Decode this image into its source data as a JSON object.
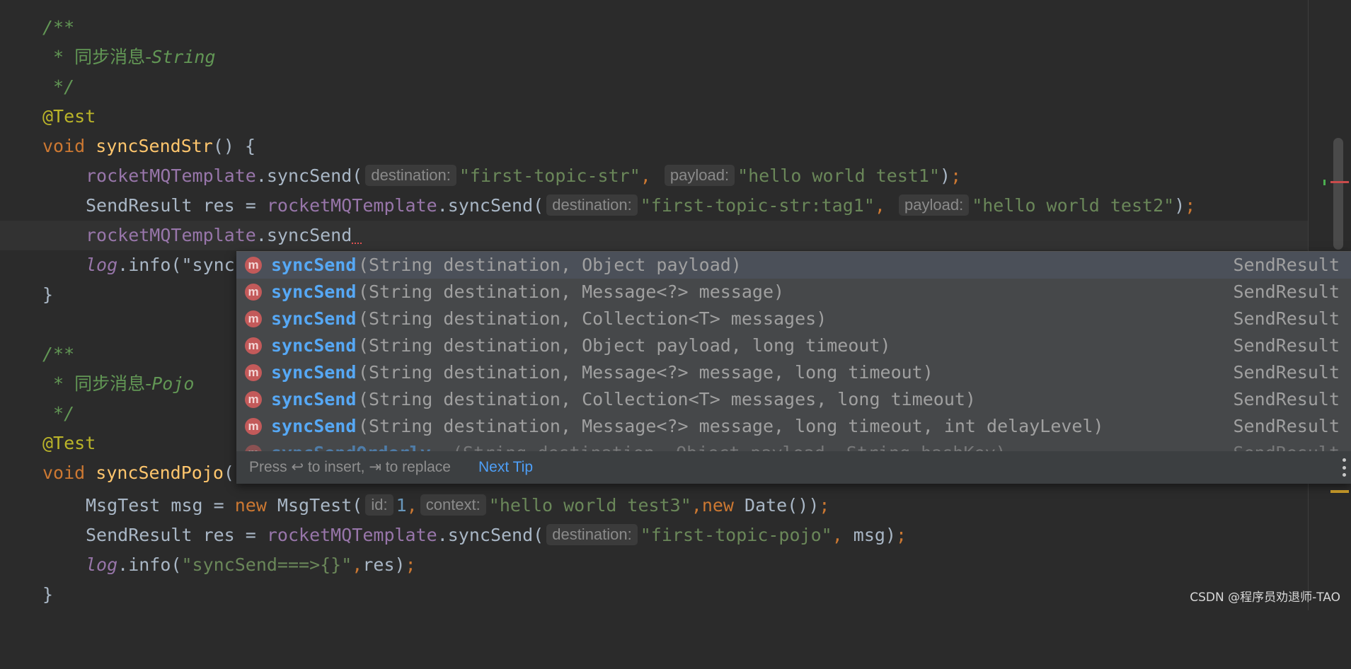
{
  "editor": {
    "comment1_open": "/**",
    "comment1_star": " * ",
    "comment1_cjk": "同步消息-",
    "comment1_word": "String",
    "comment1_close": " */",
    "annotation1": "@Test",
    "method1_kw": "void",
    "method1_name": "syncSendStr",
    "method1_rest": "() {",
    "line6": {
      "obj": "rocketMQTemplate",
      "call": ".syncSend(",
      "hint1": "destination:",
      "arg1": "\"first-topic-str\"",
      "comma1": ",",
      "hint2": "payload:",
      "arg2": "\"hello world test1\"",
      "close": ")",
      "semi": ";"
    },
    "line7": {
      "decl": "SendResult res = ",
      "obj": "rocketMQTemplate",
      "call": ".syncSend(",
      "hint1": "destination:",
      "arg1": "\"first-topic-str:tag1\"",
      "comma1": ",",
      "hint2": "payload:",
      "arg2": "\"hello world test2\"",
      "close": ")",
      "semi": ";"
    },
    "line8": {
      "obj": "rocketMQTemplate",
      "call": ".syncSend"
    },
    "line9": {
      "log": "log",
      "rest": ".info(\"sync"
    },
    "close_brace1": "}",
    "comment2_open": "/**",
    "comment2_star": " * ",
    "comment2_cjk": "同步消息-",
    "comment2_word": "Pojo",
    "comment2_close": " */",
    "annotation2": "@Test",
    "method2_kw": "void",
    "method2_name": "syncSendPojo",
    "method2_rest": "(",
    "line16": {
      "decl": "MsgTest msg = ",
      "kw_new": "new",
      "ctor": " MsgTest(",
      "hint1": "id:",
      "num": "1",
      "comma1": ",",
      "hint2": "context:",
      "arg2": "\"hello world test3\"",
      "comma2": ",",
      "kw_new2": "new",
      "date": " Date())",
      "semi": ";"
    },
    "line17": {
      "decl": "SendResult res = ",
      "obj": "rocketMQTemplate",
      "call": ".syncSend(",
      "hint1": "destination:",
      "arg1": "\"first-topic-pojo\"",
      "comma1": ",",
      "rest": " msg)",
      "semi": ";"
    },
    "line18": {
      "log": "log",
      "call": ".info(",
      "str": "\"syncSend===>{}\"",
      "comma": ",",
      "rest": "res)",
      "semi": ";"
    },
    "close_brace2": "}"
  },
  "completion": {
    "items": [
      {
        "icon": "m",
        "name": "syncSend",
        "params": "(String destination, Object payload)",
        "type": "SendResult"
      },
      {
        "icon": "m",
        "name": "syncSend",
        "params": "(String destination, Message<?> message)",
        "type": "SendResult"
      },
      {
        "icon": "m",
        "name": "syncSend",
        "params": "(String destination, Collection<T> messages)",
        "type": "SendResult"
      },
      {
        "icon": "m",
        "name": "syncSend",
        "params": "(String destination, Object payload, long timeout)",
        "type": "SendResult"
      },
      {
        "icon": "m",
        "name": "syncSend",
        "params": "(String destination, Message<?> message, long timeout)",
        "type": "SendResult"
      },
      {
        "icon": "m",
        "name": "syncSend",
        "params": "(String destination, Collection<T> messages, long timeout)",
        "type": "SendResult"
      },
      {
        "icon": "m",
        "name": "syncSend",
        "params": "(String destination, Message<?> message, long timeout, int delayLevel)",
        "type": "SendResult"
      },
      {
        "icon": "m",
        "name": "syncSendOrderly",
        "params": "(String destination, Object payload, String hashKey)",
        "type": "SendResult"
      }
    ],
    "footer_text": "Press ↩ to insert, ⇥ to replace",
    "next_tip": "Next Tip"
  },
  "watermark": "CSDN @程序员劝退师-TAO"
}
